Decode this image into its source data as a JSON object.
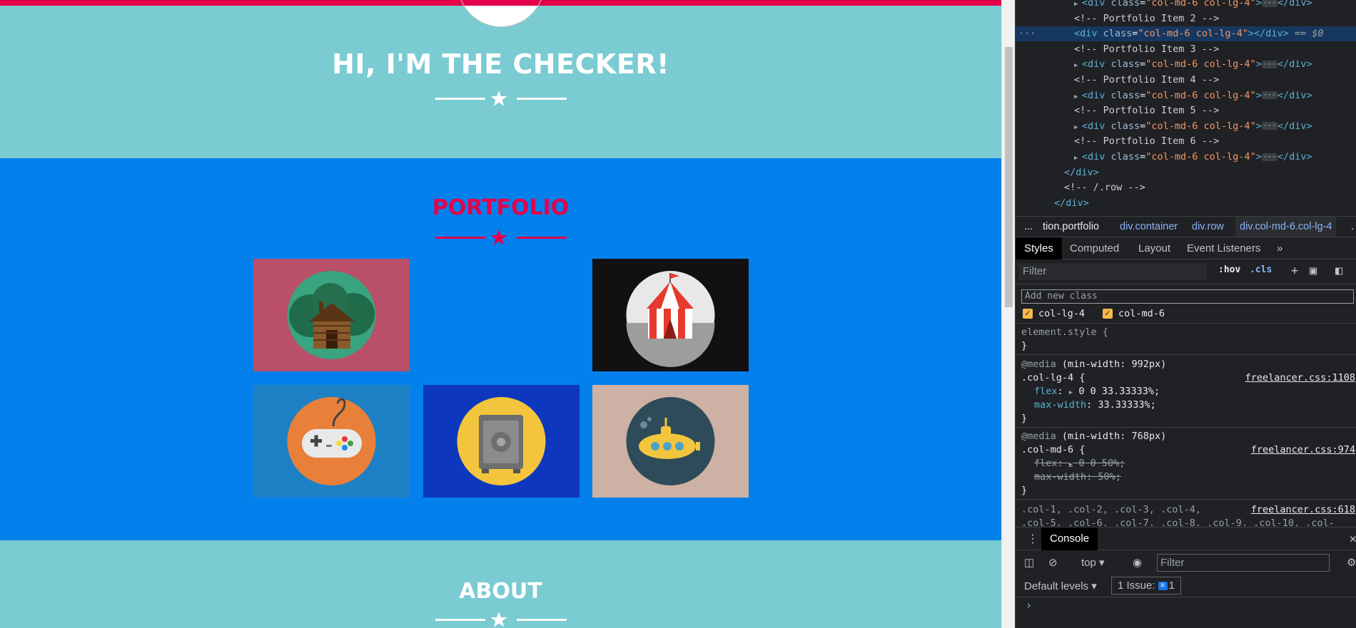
{
  "page": {
    "hero_title": "HI, I'M THE CHECKER!",
    "portfolio_title": "PORTFOLIO",
    "about_title": "ABOUT",
    "colors": {
      "primary_red": "#e5004b",
      "hero_bg": "#7acbd2",
      "portfolio_bg": "#0380ec"
    },
    "portfolio_items": [
      {
        "name": "cabin",
        "icon": "cabin-icon",
        "bg": "#b94f68"
      },
      {
        "name": "empty",
        "icon": "",
        "bg": ""
      },
      {
        "name": "circus-tent",
        "icon": "circus-tent-icon",
        "bg": "#121011"
      },
      {
        "name": "game-controller",
        "icon": "game-controller-icon",
        "bg": "#1e80c4"
      },
      {
        "name": "safe",
        "icon": "safe-icon",
        "bg": "#0d37bd"
      },
      {
        "name": "submarine",
        "icon": "submarine-icon",
        "bg": "#cdb1a4"
      }
    ]
  },
  "devtools": {
    "dom_lines": [
      {
        "indent": 4,
        "tri": "▶",
        "tag": "div",
        "cls": "col-md-6 col-lg-4",
        "tail": "</div>"
      },
      {
        "indent": 4,
        "comment": "<!-- Portfolio Item 2 -->"
      },
      {
        "indent": 4,
        "tag": "div",
        "cls": "col-md-6 col-lg-4",
        "selected": true,
        "tail": "</div> == $0"
      },
      {
        "indent": 4,
        "comment": "<!-- Portfolio Item 3 -->"
      },
      {
        "indent": 4,
        "tri": "▶",
        "tag": "div",
        "cls": "col-md-6 col-lg-4",
        "tail": "</div>"
      },
      {
        "indent": 4,
        "comment": "<!-- Portfolio Item 4 -->"
      },
      {
        "indent": 4,
        "tri": "▶",
        "tag": "div",
        "cls": "col-md-6 col-lg-4",
        "tail": "</div>"
      },
      {
        "indent": 4,
        "comment": "<!-- Portfolio Item 5 -->"
      },
      {
        "indent": 4,
        "tri": "▶",
        "tag": "div",
        "cls": "col-md-6 col-lg-4",
        "tail": "</div>"
      },
      {
        "indent": 4,
        "comment": "<!-- Portfolio Item 6 -->"
      },
      {
        "indent": 4,
        "tri": "▶",
        "tag": "div",
        "cls": "col-md-6 col-lg-4",
        "tail": "</div>"
      },
      {
        "indent": 3,
        "close": "</div>"
      },
      {
        "indent": 3,
        "comment": "<!-- /.row -->"
      },
      {
        "indent": 2,
        "close": "</div>"
      }
    ],
    "breadcrumbs": {
      "ellipsis": "...",
      "items": [
        "tion.portfolio",
        "div.container",
        "div.row",
        "div.col-md-6.col-lg-4"
      ],
      "more": "."
    },
    "tabs": [
      "Styles",
      "Computed",
      "Layout",
      "Event Listeners",
      "»"
    ],
    "filter_placeholder": "Filter",
    "hov_label": ":hov",
    "cls_label": ".cls",
    "add_class_placeholder": "Add new class",
    "class_toggles": [
      "col-lg-4",
      "col-md-6"
    ],
    "rules": {
      "element_style": "element.style {",
      "close_brace": "}",
      "media1": "(min-width: 992px)",
      "media_kw": "@media",
      "selector1": ".col-lg-4 {",
      "source1": "freelancer.css:1108",
      "flex_prop": "flex",
      "flex_val1": "0 0 33.33333%;",
      "maxw_prop": "max-width",
      "maxw_val1": "33.33333%;",
      "media2": "(min-width: 768px)",
      "selector2": ".col-md-6 {",
      "source2": "freelancer.css:974",
      "flex_val2": "0 0 50%;",
      "maxw_val2": "50%;",
      "selector3": ".col-1, .col-2, .col-3, .col-4,",
      "selector3b": ".col-5, .col-6, .col-7, .col-8, .col-9, .col-10, .col-",
      "source3": "freelancer.css:618"
    },
    "console": {
      "tab": "Console",
      "context": "top",
      "filter_placeholder": "Filter",
      "levels": "Default levels",
      "issues_label": "1 Issue:",
      "issues_count": "1",
      "prompt": "›"
    }
  }
}
